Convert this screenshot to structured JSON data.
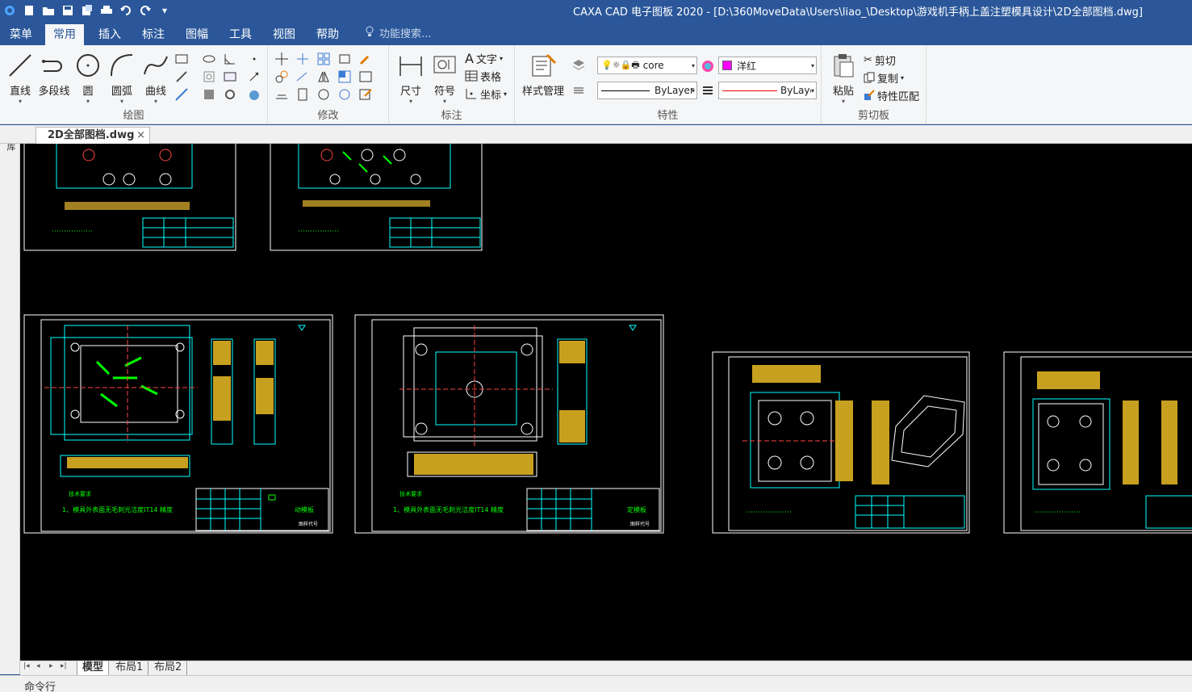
{
  "window": {
    "title": "CAXA CAD 电子图板 2020 - [D:\\360MoveData\\Users\\liao_\\Desktop\\游戏机手柄上盖注塑模具设计\\2D全部图档.dwg]"
  },
  "menu_tabs": [
    "菜单",
    "常用",
    "插入",
    "标注",
    "图幅",
    "工具",
    "视图",
    "帮助"
  ],
  "active_tab": "常用",
  "search_placeholder": "功能搜索...",
  "ribbon": {
    "draw": {
      "label": "绘图",
      "line": "直线",
      "polyline": "多段线",
      "circle": "圆",
      "arc": "圆弧",
      "curve": "曲线"
    },
    "modify": {
      "label": "修改"
    },
    "annotate": {
      "label": "标注",
      "dimension": "尺寸",
      "symbol": "符号",
      "text": "文字",
      "table": "表格",
      "coordinate": "坐标"
    },
    "properties": {
      "label": "特性",
      "style_manager": "样式管理",
      "layer_value": "core",
      "color_value": "洋红",
      "linetype_value": "ByLayer",
      "lineweight_value": "ByLayer",
      "color_hex": "#ff00ff"
    },
    "clipboard": {
      "label": "剪切板",
      "paste": "粘贴",
      "cut": "剪切",
      "copy": "复制",
      "match": "特性匹配"
    }
  },
  "document_tab": "2D全部图档.dwg",
  "left_panel_label": "图库",
  "layout_tabs": [
    "模型",
    "布局1",
    "布局2"
  ],
  "active_layout": "模型",
  "command_line": "命令行",
  "drawings": [
    {
      "note_title": "技术要求",
      "note_text": "1、模具外表面无毛刺光洁度IT14 精度",
      "title_block": "动模板",
      "sub": "图样代号"
    },
    {
      "note_title": "技术要求",
      "note_text": "1、模具外表面无毛刺光洁度IT14 精度",
      "title_block": "定模板",
      "sub": "图样代号"
    }
  ]
}
